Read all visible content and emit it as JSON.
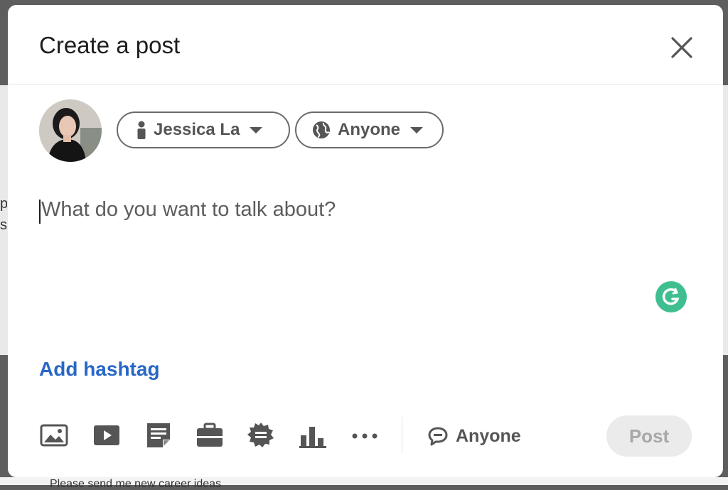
{
  "dialog": {
    "title": "Create a post"
  },
  "author": {
    "name": "Jessica La"
  },
  "visibility": {
    "label": "Anyone"
  },
  "editor": {
    "placeholder": "What do you want to talk about?"
  },
  "hashtag": {
    "label": "Add hashtag"
  },
  "toolbar": {
    "icons": [
      "photo-icon",
      "video-icon",
      "document-icon",
      "job-icon",
      "celebrate-icon",
      "poll-icon",
      "more-icon"
    ],
    "comment_control_label": "Anyone",
    "post_label": "Post"
  },
  "background": {
    "peek_text": "Please send me new career ideas",
    "left_letters": "p s"
  },
  "colors": {
    "accent_blue": "#2867c6",
    "grammarly_green": "#3fbf8f",
    "icon_gray": "#555555",
    "post_disabled_bg": "#ebebeb"
  }
}
